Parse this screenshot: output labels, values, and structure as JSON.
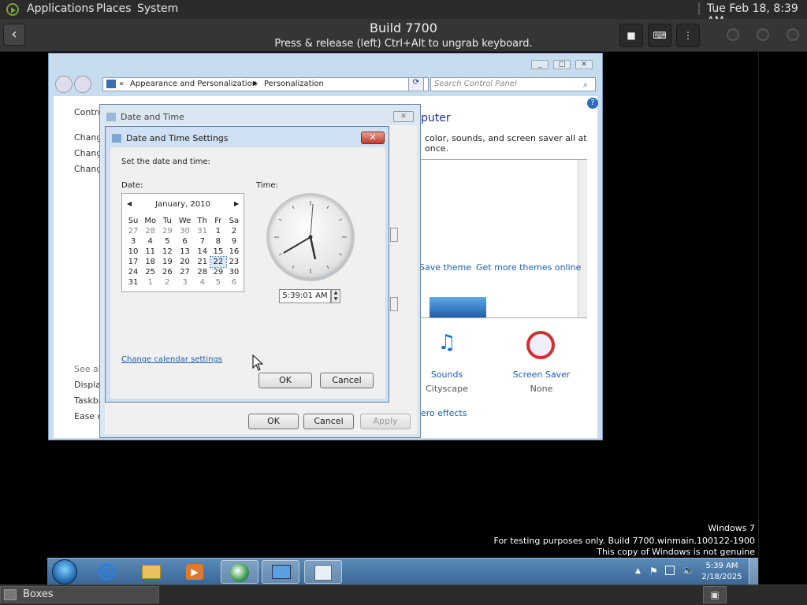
{
  "gnome_panel": {
    "menus": [
      "Applications",
      "Places",
      "System"
    ],
    "datetime": "Tue Feb 18,  8:39 AM"
  },
  "boxes_header": {
    "title": "Build 7700",
    "subtitle": "Press & release (left) Ctrl+Alt to ungrab keyboard."
  },
  "control_panel": {
    "breadcrumb": [
      "Appearance and Personalization",
      "Personalization"
    ],
    "breadcrumb_prefix": "«",
    "search_placeholder": "Search Control Panel",
    "left_title": "Contro",
    "left_links": [
      "Change",
      "Change",
      "Change"
    ],
    "see_also_label": "See als",
    "see_also_links": [
      "Display",
      "Taskba",
      "Ease of"
    ],
    "heading": "puter",
    "description": "color, sounds, and screen saver all at once.",
    "theme_links": [
      "Save theme",
      "Get more themes online"
    ],
    "items": [
      {
        "label": "Sounds",
        "value": "Cityscape"
      },
      {
        "label": "Screen Saver",
        "value": "None"
      }
    ],
    "aero_link": "ero effects"
  },
  "date_time_dialog": {
    "title": "Date and Time",
    "ok": "OK",
    "cancel": "Cancel",
    "apply": "Apply"
  },
  "date_time_settings": {
    "title": "Date and Time Settings",
    "prompt": "Set the date and time:",
    "date_label": "Date:",
    "time_label": "Time:",
    "calendar": {
      "month": "January, 2010",
      "weekdays": [
        "Su",
        "Mo",
        "Tu",
        "We",
        "Th",
        "Fr",
        "Sa"
      ],
      "weeks": [
        [
          "27",
          "28",
          "29",
          "30",
          "31",
          "1",
          "2"
        ],
        [
          "3",
          "4",
          "5",
          "6",
          "7",
          "8",
          "9"
        ],
        [
          "10",
          "11",
          "12",
          "13",
          "14",
          "15",
          "16"
        ],
        [
          "17",
          "18",
          "19",
          "20",
          "21",
          "22",
          "23"
        ],
        [
          "24",
          "25",
          "26",
          "27",
          "28",
          "29",
          "30"
        ],
        [
          "31",
          "1",
          "2",
          "3",
          "4",
          "5",
          "6"
        ]
      ],
      "selected_day": "22"
    },
    "time_value": "5:39:01 AM",
    "calendar_link": "Change calendar settings",
    "ok": "OK",
    "cancel": "Cancel"
  },
  "watermark": {
    "line1": "Windows 7",
    "line2": "For testing purposes only. Build 7700.winmain.100122-1900",
    "line3": "This copy of Windows is not genuine"
  },
  "taskbar": {
    "time": "5:39 AM",
    "date": "2/18/2025"
  },
  "host_bar": {
    "app_label": "Boxes"
  }
}
